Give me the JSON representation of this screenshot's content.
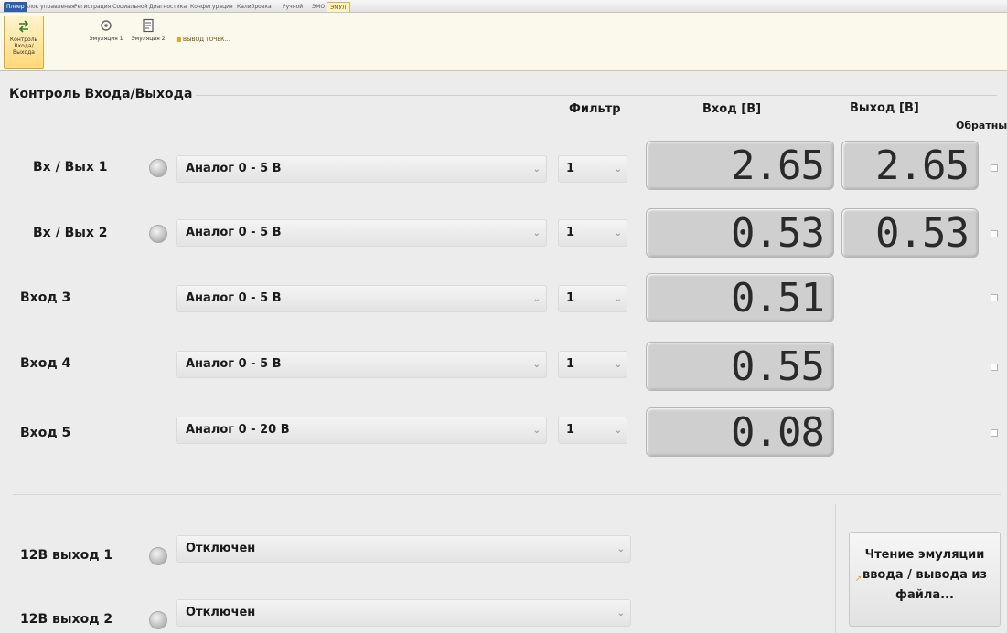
{
  "tabs": [
    "Плеер",
    "Блок управления",
    "Регистрация Социальной",
    "Диагностика",
    "Конфигурация",
    "Калибровка",
    "Ручной",
    "ЭМО",
    "ЭМУЛ"
  ],
  "ribbon": {
    "buttons": [
      {
        "label1": "Контроль",
        "label2": "Входа/Выхода"
      },
      {
        "label1": "Эмуляция 1",
        "label2": ""
      },
      {
        "label1": "Эмуляция 2",
        "label2": ""
      }
    ],
    "small_action": "ВЫВОД ТОЧЕК..."
  },
  "group_title": "Контроль Входа/Выхода",
  "headers": {
    "filter": "Фильтр",
    "input": "Вход [В]",
    "output": "Выход [В]",
    "reverse": "Обратный"
  },
  "rows": [
    {
      "label": "Вх / Вых 1",
      "mode": "Аналог 0 - 5 В",
      "filter": "1",
      "input": "2.65",
      "output": "2.65"
    },
    {
      "label": "Вх / Вых 2",
      "mode": "Аналог 0 - 5 В",
      "filter": "1",
      "input": "0.53",
      "output": "0.53"
    },
    {
      "label": "Вход 3",
      "mode": "Аналог 0 - 5 В",
      "filter": "1",
      "input": "0.51"
    },
    {
      "label": "Вход 4",
      "mode": "Аналог 0 - 5 В",
      "filter": "1",
      "input": "0.55"
    },
    {
      "label": "Вход 5",
      "mode": "Аналог 0 - 20 В",
      "filter": "1",
      "input": "0.08"
    }
  ],
  "outputs12v": [
    {
      "label": "12В выход 1",
      "mode": "Отключен"
    },
    {
      "label": "12В выход 2",
      "mode": "Отключен"
    }
  ],
  "read_button": {
    "line1": "Чтение эмуляции",
    "line2": "ввода / вывода из",
    "line3": "файла..."
  },
  "dropdown_arrow": "⌄"
}
